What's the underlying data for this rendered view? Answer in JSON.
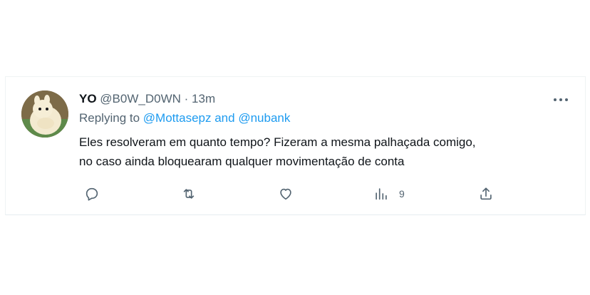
{
  "tweet": {
    "display_name": "YO",
    "handle": "@B0W_D0WN",
    "separator": "·",
    "time": "13m",
    "replying_prefix": "Replying to",
    "reply_mention_1": "@Mottasepz",
    "reply_conjunction": "and",
    "reply_mention_2": "@nubank",
    "text_line_1": "Eles resolveram em quanto tempo? Fizeram a mesma palhaçada comigo,",
    "text_line_2": "no caso ainda bloquearam qualquer movimentação de conta"
  },
  "actions": {
    "reply_icon": "reply-icon",
    "retweet_icon": "retweet-icon",
    "like_icon": "heart-icon",
    "views_icon": "views-icon",
    "views_count": "9",
    "share_icon": "share-icon"
  },
  "colors": {
    "text": "#0f1419",
    "secondary": "#536471",
    "link": "#1d9bf0",
    "border": "#eff3f4"
  }
}
